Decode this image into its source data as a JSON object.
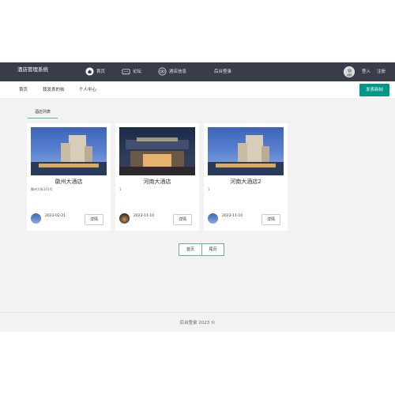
{
  "header": {
    "brand": "酒店管理系统",
    "nav": [
      {
        "label": "首页",
        "icon": "home-icon"
      },
      {
        "label": "论坛",
        "icon": "chat-icon"
      },
      {
        "label": "酒店信息",
        "icon": "eye-icon"
      },
      {
        "label": "后台登录"
      }
    ],
    "login_label": "登入",
    "register_label": "注册"
  },
  "subnav": {
    "items": [
      "首页",
      "我发表的帖",
      "个人中心"
    ],
    "post_button": "发表新帖"
  },
  "section_tab": "酒店列表",
  "hotels": [
    {
      "title": "徽州大酒店",
      "address": "徽州大街101号",
      "date": "2023-02-21",
      "detail_label": "详情"
    },
    {
      "title": "河南大酒店",
      "address": "1",
      "date": "2023-11-10",
      "detail_label": "详情"
    },
    {
      "title": "河南大酒店2",
      "address": "1",
      "date": "2023-11-10",
      "detail_label": "详情"
    }
  ],
  "pagination": {
    "first": "首页",
    "last": "尾页"
  },
  "footer": {
    "text": "后台登录 2023 ©"
  }
}
